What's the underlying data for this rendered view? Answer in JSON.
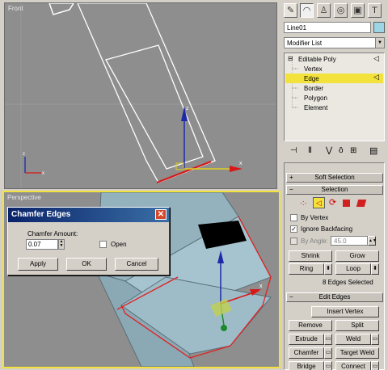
{
  "viewports": {
    "front_label": "Front",
    "persp_label": "Perspective"
  },
  "dialog": {
    "title": "Chamfer Edges",
    "close": "✕",
    "amount_label": "Chamfer Amount:",
    "amount_value": "0.07",
    "open_label": "Open",
    "apply": "Apply",
    "ok": "OK",
    "cancel": "Cancel"
  },
  "panel": {
    "tab_icons": [
      "create-icon",
      "modify-icon",
      "hierarchy-icon",
      "motion-icon",
      "display-icon",
      "utilities-icon"
    ],
    "object_name": "Line01",
    "modifier_list": "Modifier List",
    "stack": {
      "root": "Editable Poly",
      "items": [
        "Vertex",
        "Edge",
        "Border",
        "Polygon",
        "Element"
      ]
    },
    "soft_selection": "Soft Selection",
    "selection": {
      "title": "Selection",
      "by_vertex": "By Vertex",
      "ignore_backfacing": "Ignore Backfacing",
      "by_angle": "By Angle:",
      "angle_value": "45.0",
      "shrink": "Shrink",
      "grow": "Grow",
      "ring": "Ring",
      "loop": "Loop",
      "status": "8 Edges Selected"
    },
    "edit_edges": {
      "title": "Edit Edges",
      "insert_vertex": "Insert Vertex",
      "remove": "Remove",
      "split": "Split",
      "extrude": "Extrude",
      "weld": "Weld",
      "chamfer": "Chamfer",
      "target_weld": "Target Weld",
      "bridge": "Bridge",
      "connect": "Connect"
    },
    "colors": {
      "accent_yellow": "#f4e23c",
      "object_swatch": "#9cd6e6",
      "title_bar": "#0a246a"
    }
  }
}
